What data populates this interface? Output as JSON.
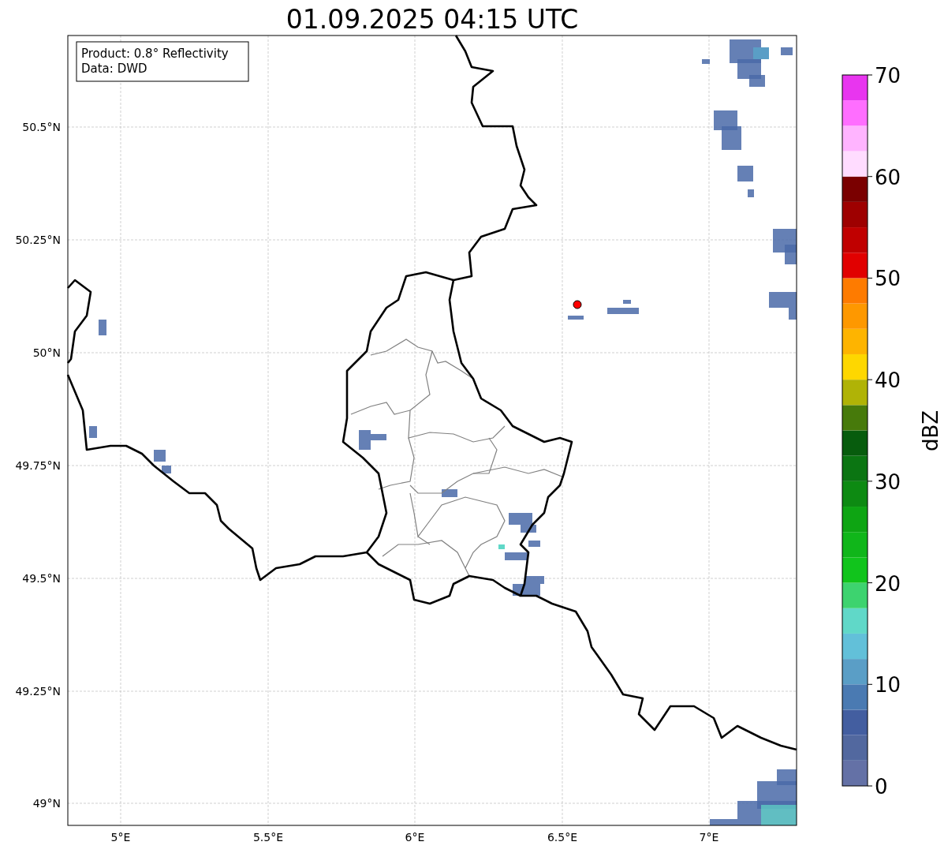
{
  "title": "01.09.2025 04:15 UTC",
  "info_box": [
    "Product: 0.8° Reflectivity",
    "Data: DWD"
  ],
  "map": {
    "xticks": [
      "5°E",
      "5.5°E",
      "6°E",
      "6.5°E",
      "7°E"
    ],
    "yticks": [
      "50.5°N",
      "50.25°N",
      "50°N",
      "49.75°N",
      "49.5°N",
      "49.25°N",
      "49°N"
    ]
  },
  "colorbar": {
    "label": "dBZ",
    "ticks": [
      "70",
      "60",
      "50",
      "40",
      "30",
      "20",
      "10",
      "0"
    ],
    "bands": [
      {
        "color": "#6471a6"
      },
      {
        "color": "#52689f"
      },
      {
        "color": "#435ea0"
      },
      {
        "color": "#4a7ab2"
      },
      {
        "color": "#5a9ec6"
      },
      {
        "color": "#62c0d9"
      },
      {
        "color": "#60d8c8"
      },
      {
        "color": "#3dd36f"
      },
      {
        "color": "#11c41c"
      },
      {
        "color": "#10b61a"
      },
      {
        "color": "#0ea513"
      },
      {
        "color": "#0d8a12"
      },
      {
        "color": "#0b7512"
      },
      {
        "color": "#075c0d"
      },
      {
        "color": "#477a0b"
      },
      {
        "color": "#b0b306"
      },
      {
        "color": "#fed700"
      },
      {
        "color": "#feb400"
      },
      {
        "color": "#fe9800"
      },
      {
        "color": "#fe7b00"
      },
      {
        "color": "#e10000"
      },
      {
        "color": "#c00000"
      },
      {
        "color": "#9e0000"
      },
      {
        "color": "#7a0000"
      },
      {
        "color": "#ffdcff"
      },
      {
        "color": "#ffb4ff"
      },
      {
        "color": "#ff6eff"
      },
      {
        "color": "#e835ef"
      }
    ]
  }
}
